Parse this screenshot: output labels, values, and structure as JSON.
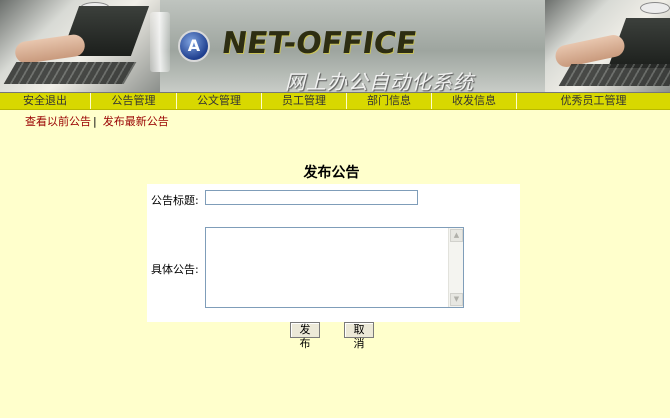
{
  "banner": {
    "logo_letter": "A",
    "brand": "NET-OFFICE",
    "subtitle": "网上办公自动化系统"
  },
  "nav": {
    "items": [
      {
        "label": "安全退出"
      },
      {
        "label": "公告管理"
      },
      {
        "label": "公文管理"
      },
      {
        "label": "员工管理"
      },
      {
        "label": "部门信息"
      },
      {
        "label": "收发信息"
      },
      {
        "label": "优秀员工管理"
      }
    ],
    "bg_color": "#d8d800"
  },
  "sublinks": {
    "view_old": "查看以前公告",
    "separator": "|",
    "publish_new": "发布最新公告"
  },
  "form": {
    "heading": "发布公告",
    "title_label": "公告标题:",
    "title_value": "",
    "content_label": "具体公告:",
    "content_value": "",
    "scroll_up_glyph": "▲",
    "scroll_down_glyph": "▼",
    "submit_label": "发布",
    "cancel_label": "取消"
  },
  "colors": {
    "page_bg": "#ffffcc",
    "link": "#990000"
  }
}
